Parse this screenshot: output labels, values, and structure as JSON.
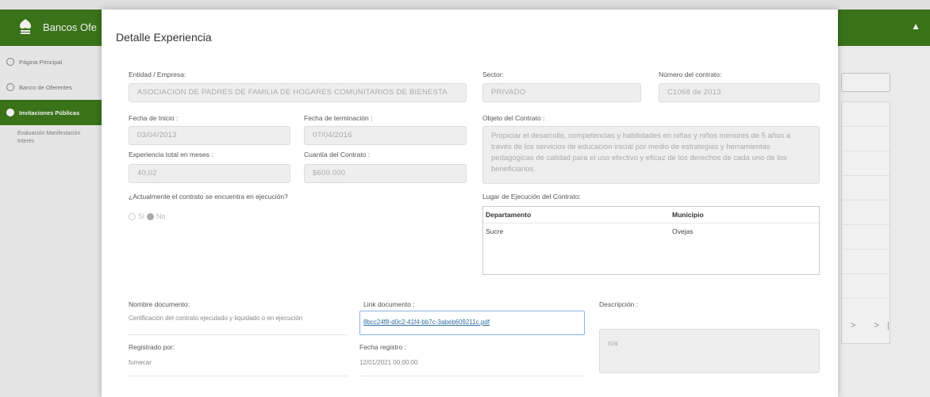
{
  "app": {
    "brand": "Bancos Ofe"
  },
  "sidebar": {
    "items": [
      {
        "label": "Página Principal"
      },
      {
        "label": "Banco de Oferentes"
      },
      {
        "label": "Invitaciones Públicas"
      }
    ],
    "sub_item": "Evaluación Manifestación Interés"
  },
  "background": {
    "pager": "> >|"
  },
  "modal": {
    "title": "Detalle Experiencia",
    "entidad_label": "Entidad / Empresa:",
    "entidad_value": "ASOCIACION DE PADRES DE FAMILIA DE HOGARES COMUNITARIOS DE BIENESTA",
    "sector_label": "Sector:",
    "sector_value": "PRIVADO",
    "numero_label": "Número del contrato:",
    "numero_value": "C1068 de 2013",
    "fecha_inicio_label": "Fecha de Inicio :",
    "fecha_inicio_value": "03/04/2013",
    "fecha_term_label": "Fecha de terminación :",
    "fecha_term_value": "07/04/2016",
    "objeto_label": "Objeto del Contrato :",
    "objeto_value": "Propiciar el desarrollo, competencias y habilidades en niñas y niños menores de 5 años a través de los servicios de educación inicial por medio de estrategias y herramientas pedagógicas de calidad para el uso efectivo y eficaz de los derechos de cada uno de los beneficiarios.",
    "experiencia_label": "Experiencia total en meses :",
    "experiencia_value": "40,02",
    "cuantia_label": "Cuantía del Contrato :",
    "cuantia_value": "$600.000",
    "ejecucion_question": "¿Actualmente el contrato se encuentra en ejecución?",
    "radio_si": "Si",
    "radio_no": "No",
    "radio_selected": "No",
    "lugar_label": "Lugar de Ejecución del Contrato:",
    "lugar_table": {
      "headers": [
        "Departamento",
        "Municipio"
      ],
      "rows": [
        [
          "Sucre",
          "Ovejas"
        ]
      ]
    },
    "nombre_doc_label": "Nombre documento:",
    "nombre_doc_value": "Certificación del contrato ejecutado y liquidado o en ejecución",
    "link_doc_label": "Link documento :",
    "link_doc_value": "8bcc24f8-d0c2-41f4-bb7c-3abeb609211c.pdf",
    "descripcion_label": "Descripción :",
    "descripcion_value": "n/a",
    "registrado_label": "Registrado por:",
    "registrado_value": "fumecar",
    "fecha_registro_label": "Fecha registro :",
    "fecha_registro_value": "12/01/2021 00:00:00"
  },
  "colors": {
    "brand_green": "#3e7a1b",
    "link_blue": "#2e6da4"
  }
}
